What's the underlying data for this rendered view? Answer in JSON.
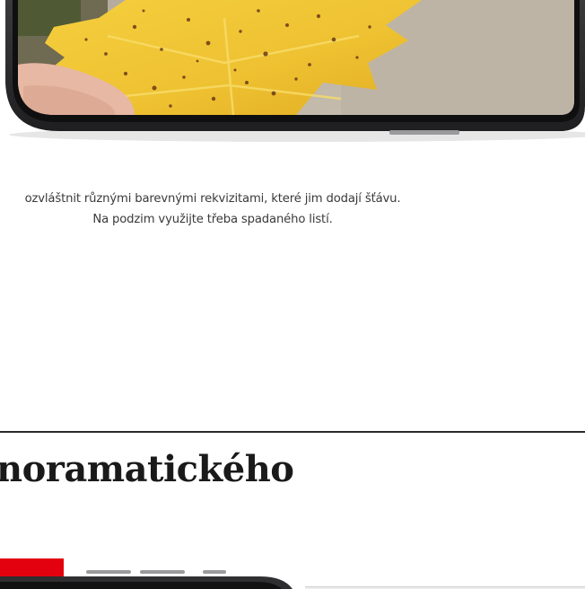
{
  "colors": {
    "accent_red": "#e3000f",
    "heading_text": "#1a1a1a",
    "body_text": "#3a3a3a",
    "divider": "#2a2a2a",
    "leaf_yellow": "#f2c733",
    "phone_frame": "#2f2f31"
  },
  "article": {
    "photo": {
      "subject": "yellow-maple-leaf-held-in-hand",
      "device": "smartphone-landscape"
    },
    "caption": {
      "line1": "ozvláštnit různými barevnými rekvizitami, které jim dodají šťávu.",
      "line2": "Na podzim využijte třeba spadaného listí."
    },
    "section": {
      "heading": "noramatického"
    }
  }
}
